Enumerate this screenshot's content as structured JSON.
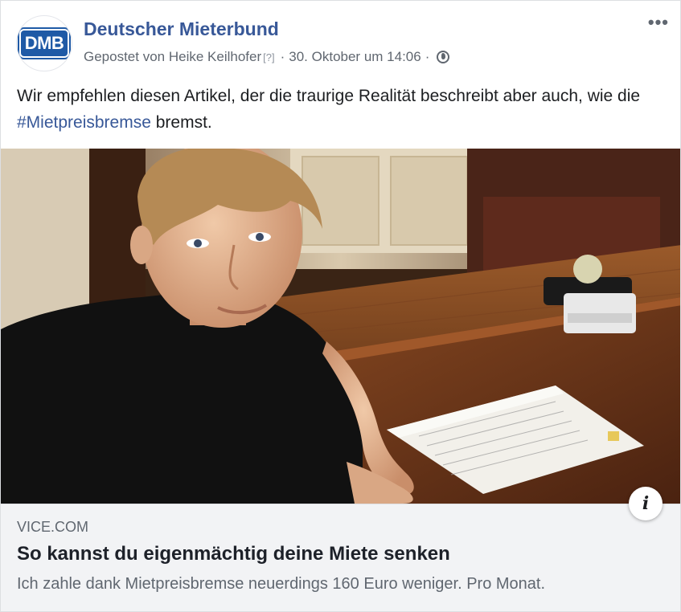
{
  "post": {
    "page_name": "Deutscher Mieterbund",
    "avatar_text": "DMB",
    "meta_prefix": "Gepostet von Heike Keilhofer",
    "meta_question": "[?]",
    "meta_date": "30. Oktober um 14:06",
    "more_label": "•••",
    "text_before": "Wir empfehlen diesen Artikel, der die traurige Realität beschreibt aber auch, wie die",
    "hashtag": "#Mietpreisbremse",
    "text_after": "bremst.",
    "icons": {
      "privacy": "globe-icon",
      "more": "more-options-icon",
      "info": "info-icon"
    }
  },
  "link": {
    "domain": "VICE.COM",
    "title": "So kannst du eigenmächtig deine Miete senken",
    "description": "Ich zahle dank Mietpreisbremse neuerdings 160 Euro weniger. Pro Monat.",
    "info_label": "i"
  },
  "colors": {
    "link_blue": "#385898",
    "meta_gray": "#606770",
    "preview_bg": "#f2f3f5"
  }
}
